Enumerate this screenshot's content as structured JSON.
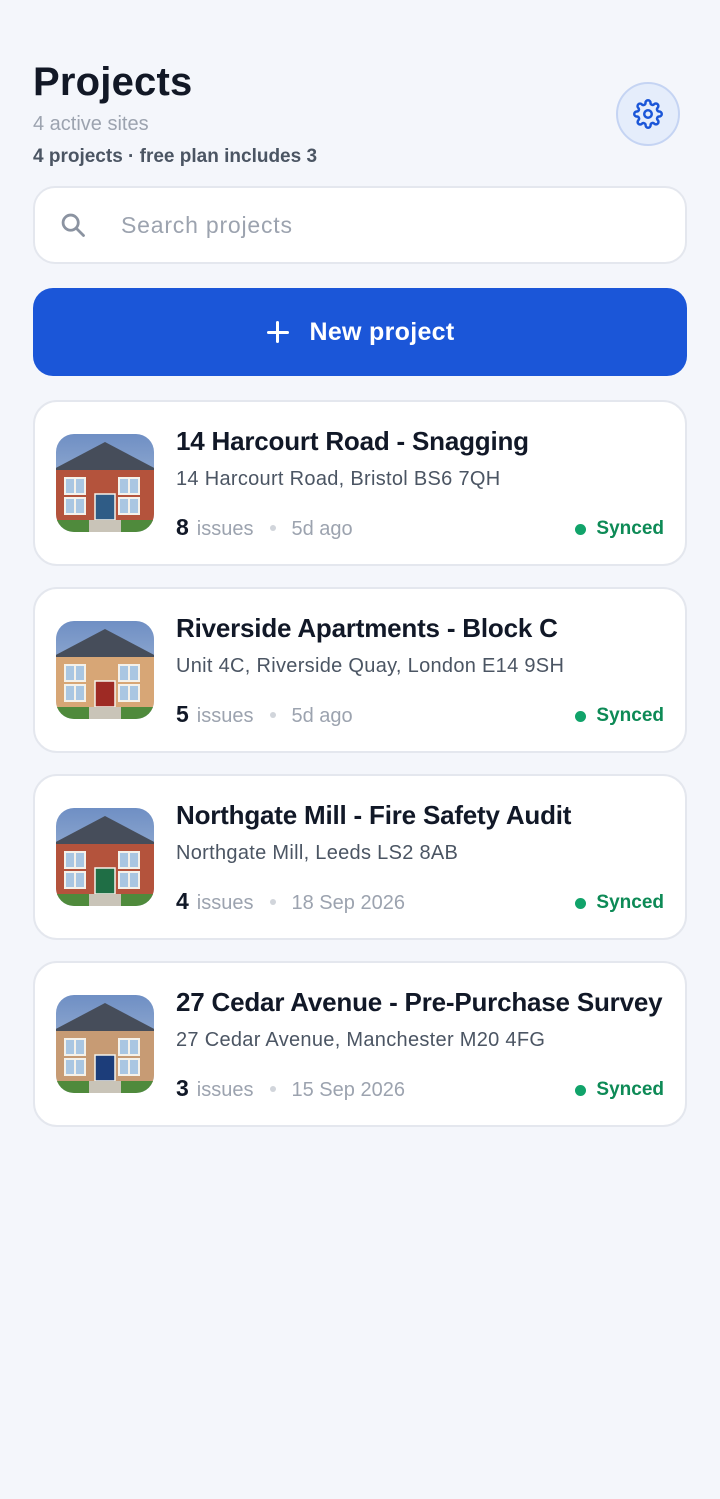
{
  "header": {
    "title": "Projects",
    "subtitle": "4 active sites",
    "plan_note": "4 projects · free plan includes 3",
    "settings_icon": "gear-icon"
  },
  "search": {
    "placeholder": "Search projects",
    "icon": "search-icon"
  },
  "new_project": {
    "label": "New project",
    "icon": "plus-icon"
  },
  "colors": {
    "accent": "#1b56d8",
    "synced": "#11a36a",
    "background": "#f4f6fb"
  },
  "projects": [
    {
      "title": "14 Harcourt Road - Snagging",
      "address": "14 Harcourt Road, Bristol BS6 7QH",
      "issue_count": "8",
      "issue_label": "issues",
      "updated": "5d ago",
      "status": "Synced",
      "thumbnail": {
        "wall": "#b4533c",
        "door": "#2f5c86"
      }
    },
    {
      "title": "Riverside Apartments - Block C",
      "address": "Unit 4C, Riverside Quay, London E14 9SH",
      "issue_count": "5",
      "issue_label": "issues",
      "updated": "5d ago",
      "status": "Synced",
      "thumbnail": {
        "wall": "#d7a676",
        "door": "#9e2a24"
      }
    },
    {
      "title": "Northgate Mill - Fire Safety Audit",
      "address": "Northgate Mill, Leeds LS2 8AB",
      "issue_count": "4",
      "issue_label": "issues",
      "updated": "18 Sep 2026",
      "status": "Synced",
      "thumbnail": {
        "wall": "#b4533c",
        "door": "#1f6e45"
      }
    },
    {
      "title": "27 Cedar Avenue - Pre-Purchase Survey",
      "address": "27 Cedar Avenue, Manchester M20 4FG",
      "issue_count": "3",
      "issue_label": "issues",
      "updated": "15 Sep 2026",
      "status": "Synced",
      "thumbnail": {
        "wall": "#c79b74",
        "door": "#1c3d7a"
      }
    }
  ]
}
